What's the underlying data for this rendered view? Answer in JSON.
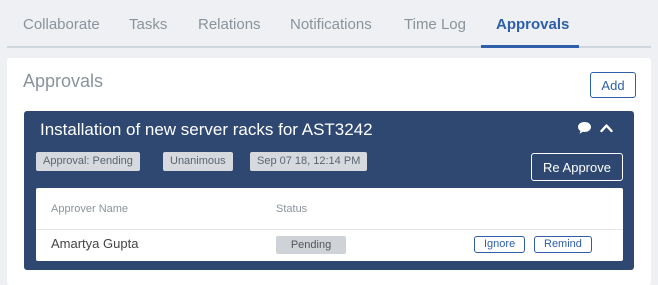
{
  "tabs": [
    {
      "label": "Collaborate",
      "active": false
    },
    {
      "label": "Tasks",
      "active": false
    },
    {
      "label": "Relations",
      "active": false
    },
    {
      "label": "Notifications",
      "active": false
    },
    {
      "label": "Time Log",
      "active": false
    },
    {
      "label": "Approvals",
      "active": true
    }
  ],
  "section": {
    "title": "Approvals",
    "add_label": "Add"
  },
  "approval": {
    "title": "Installation of new server racks for AST3242",
    "badges": [
      "Approval: Pending",
      "Unanimous",
      "Sep 07 18, 12:14 PM"
    ],
    "reapprove_label": "Re Approve",
    "icons": {
      "comment": "comment-icon",
      "collapse": "chevron-up-icon"
    },
    "table": {
      "headers": [
        "Approver Name",
        "Status"
      ],
      "rows": [
        {
          "name": "Amartya Gupta",
          "status": "Pending",
          "actions": [
            "Ignore",
            "Remind"
          ]
        }
      ]
    }
  },
  "colors": {
    "accent": "#2e5fa8",
    "panel": "#2e4872",
    "background": "#eef0f3"
  }
}
